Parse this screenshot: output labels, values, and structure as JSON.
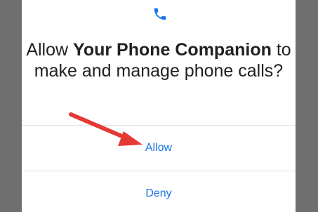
{
  "dialog": {
    "icon": "phone-icon",
    "message": {
      "part1": "Allow ",
      "app_name": "Your Phone Companion",
      "part2": " to make and manage phone calls?"
    },
    "allow_label": "Allow",
    "deny_label": "Deny"
  },
  "colors": {
    "accent": "#1a73e8",
    "arrow": "#e53935",
    "text": "#202124",
    "backdrop": "#6f6f6f"
  }
}
